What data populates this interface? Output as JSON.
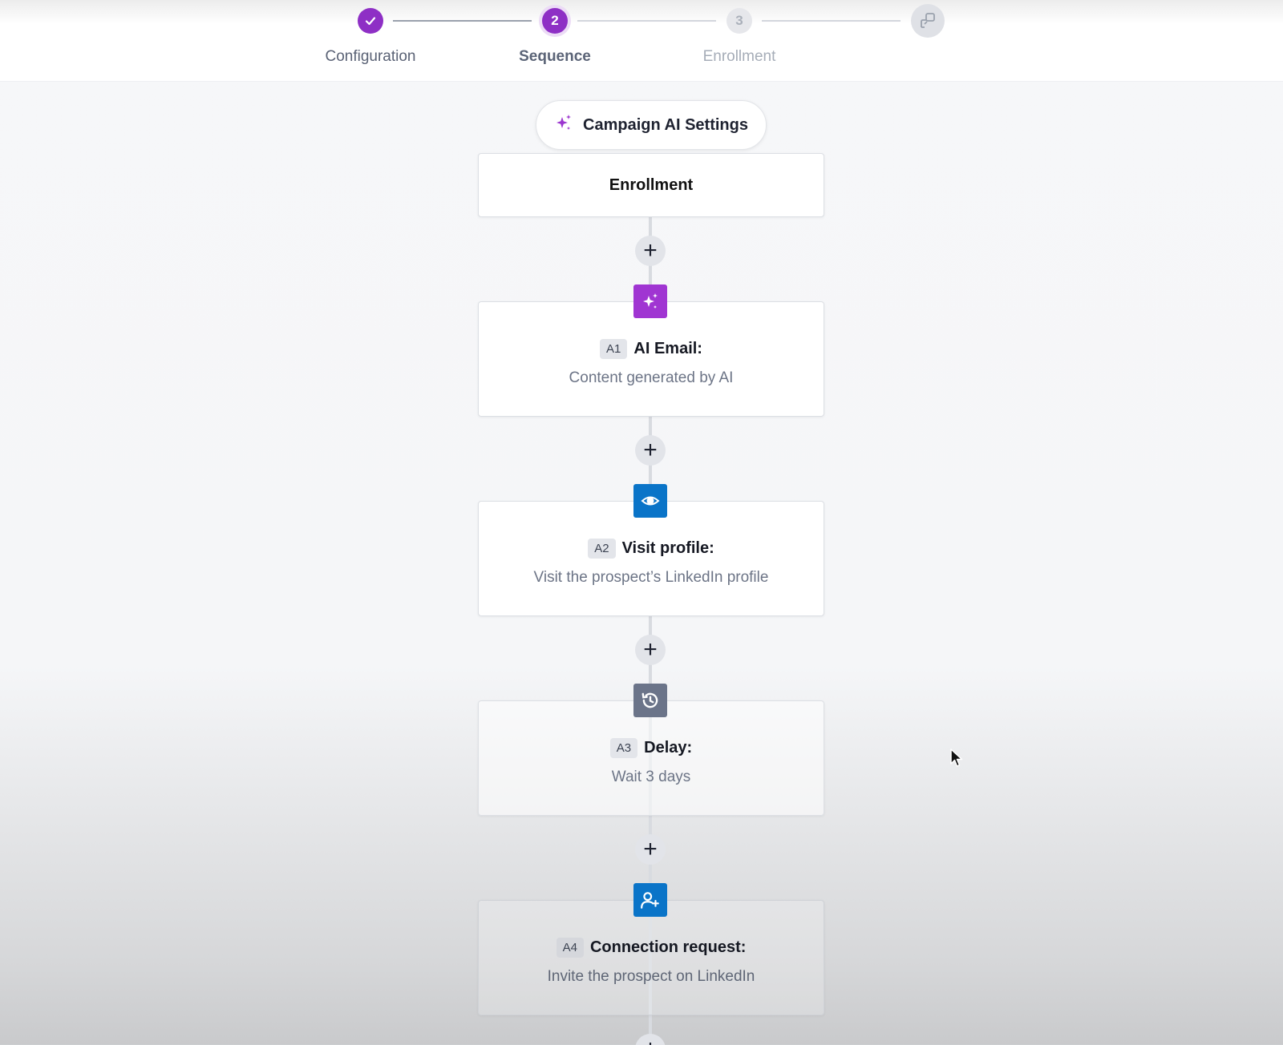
{
  "stepper": {
    "steps": [
      {
        "label": "Configuration",
        "number": "",
        "state": "done"
      },
      {
        "label": "Sequence",
        "number": "2",
        "state": "active"
      },
      {
        "label": "Enrollment",
        "number": "3",
        "state": "future"
      }
    ]
  },
  "ai_settings": {
    "label": "Campaign AI Settings"
  },
  "enrollment_card": {
    "label": "Enrollment"
  },
  "steps": [
    {
      "badge": "A1",
      "title": "AI Email:",
      "subtitle": "Content generated by AI",
      "icon": "sparkles-icon",
      "color": "#a035d2"
    },
    {
      "badge": "A2",
      "title": "Visit profile:",
      "subtitle": "Visit the prospect’s LinkedIn profile",
      "icon": "eye-icon",
      "color": "#0a74c8"
    },
    {
      "badge": "A3",
      "title": "Delay:",
      "subtitle": "Wait 3 days",
      "icon": "history-clock-icon",
      "color": "#6b7489"
    },
    {
      "badge": "A4",
      "title": "Connection request:",
      "subtitle": "Invite the prospect on LinkedIn",
      "icon": "user-plus-icon",
      "color": "#0a74c8"
    }
  ],
  "add_step": {
    "symbol": "+"
  },
  "colors": {
    "accent": "#8e2fc5",
    "linkedin_blue": "#0a74c8"
  }
}
